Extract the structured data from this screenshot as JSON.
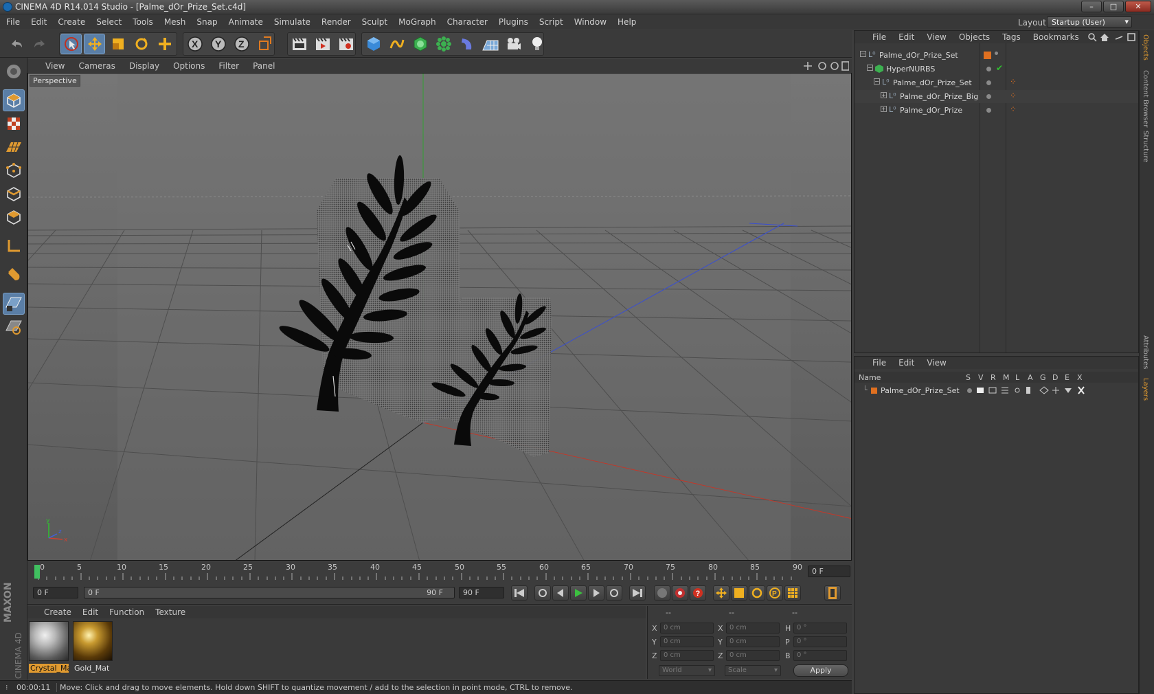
{
  "window": {
    "title": "CINEMA 4D R14.014 Studio - [Palme_dOr_Prize_Set.c4d]",
    "buttons": [
      "–",
      "□",
      "✕"
    ]
  },
  "menu": [
    "File",
    "Edit",
    "Create",
    "Select",
    "Tools",
    "Mesh",
    "Snap",
    "Animate",
    "Simulate",
    "Render",
    "Sculpt",
    "MoGraph",
    "Character",
    "Plugins",
    "Script",
    "Window",
    "Help"
  ],
  "layout": {
    "label": "Layout:",
    "value": "Startup (User)"
  },
  "viewport": {
    "menu": [
      "View",
      "Cameras",
      "Display",
      "Options",
      "Filter",
      "Panel"
    ],
    "camera_label": "Perspective",
    "axis_labels": {
      "x": "x",
      "y": "y",
      "z": "z"
    }
  },
  "timeline": {
    "ticks": [
      "0",
      "5",
      "10",
      "15",
      "20",
      "25",
      "30",
      "35",
      "40",
      "45",
      "50",
      "55",
      "60",
      "65",
      "70",
      "75",
      "80",
      "85",
      "90"
    ],
    "current_frame": "0 F"
  },
  "transport": {
    "start": "0 F",
    "range_start": "0 F",
    "range_end": "90 F",
    "end": "90 F"
  },
  "materials": {
    "menu": [
      "Create",
      "Edit",
      "Function",
      "Texture"
    ],
    "items": [
      {
        "name": "Crystal_Mat",
        "selected": true
      },
      {
        "name": "Gold_Mat",
        "selected": false
      }
    ]
  },
  "coordinates": {
    "headers": [
      "--",
      "--",
      "--"
    ],
    "rows": [
      {
        "l1": "X",
        "v1": "0 cm",
        "l2": "X",
        "v2": "0 cm",
        "l3": "H",
        "v3": "0 °"
      },
      {
        "l1": "Y",
        "v1": "0 cm",
        "l2": "Y",
        "v2": "0 cm",
        "l3": "P",
        "v3": "0 °"
      },
      {
        "l1": "Z",
        "v1": "0 cm",
        "l2": "Z",
        "v2": "0 cm",
        "l3": "B",
        "v3": "0 °"
      }
    ],
    "mode": "World",
    "type": "Scale",
    "apply": "Apply"
  },
  "status": {
    "time": "00:00:11",
    "message": "Move: Click and drag to move elements. Hold down SHIFT to quantize movement / add to the selection in point mode, CTRL to remove."
  },
  "objects": {
    "menu": [
      "File",
      "Edit",
      "View",
      "Objects",
      "Tags",
      "Bookmarks"
    ],
    "items": [
      {
        "name": "Palme_dOr_Prize_Set",
        "indent": 0
      },
      {
        "name": "HyperNURBS",
        "indent": 1
      },
      {
        "name": "Palme_dOr_Prize_Set",
        "indent": 2
      },
      {
        "name": "Palme_dOr_Prize_Big",
        "indent": 3
      },
      {
        "name": "Palme_dOr_Prize",
        "indent": 3
      }
    ]
  },
  "layers": {
    "menu": [
      "File",
      "Edit",
      "View"
    ],
    "columns": [
      "Name",
      "S",
      "V",
      "R",
      "M",
      "L",
      "A",
      "G",
      "D",
      "E",
      "X"
    ],
    "items": [
      {
        "name": "Palme_dOr_Prize_Set"
      }
    ]
  },
  "side_tabs": [
    "Objects",
    "Content Browser",
    "Structure",
    "Attributes",
    "Layers"
  ],
  "brand": {
    "maker": "MAXON",
    "product": "CINEMA 4D"
  },
  "colors": {
    "accent": "#e09a30",
    "selected_tool": "#5a7ea6",
    "x_axis": "#c0392b",
    "y_axis": "#27ae60",
    "z_axis": "#3a4fd0",
    "play": "#3cc040"
  }
}
